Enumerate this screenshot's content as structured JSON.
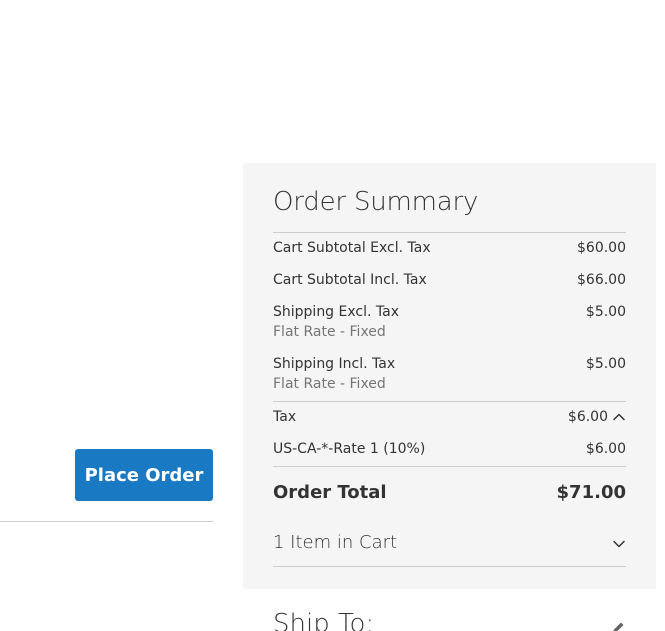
{
  "checkout": {
    "place_order_label": "Place Order"
  },
  "summary": {
    "title": "Order Summary",
    "cart_subtotal_excl_label": "Cart Subtotal Excl. Tax",
    "cart_subtotal_excl_value": "$60.00",
    "cart_subtotal_incl_label": "Cart Subtotal Incl. Tax",
    "cart_subtotal_incl_value": "$66.00",
    "shipping_excl_label": "Shipping Excl. Tax",
    "shipping_excl_method": "Flat Rate - Fixed",
    "shipping_excl_value": "$5.00",
    "shipping_incl_label": "Shipping Incl. Tax",
    "shipping_incl_method": "Flat Rate - Fixed",
    "shipping_incl_value": "$5.00",
    "tax_label": "Tax",
    "tax_value": "$6.00",
    "tax_expanded": true,
    "tax_rate_label": "US-CA-*-Rate 1 (10%)",
    "tax_rate_value": "$6.00",
    "order_total_label": "Order Total",
    "order_total_value": "$71.00",
    "items_in_cart_label": "1 Item in Cart"
  },
  "ship_to": {
    "title": "Ship To:"
  },
  "icons": {
    "tax_toggle": "chevron-up-icon",
    "items_toggle": "chevron-down-icon",
    "edit": "pencil-icon"
  },
  "colors": {
    "primary_button": "#1979c3",
    "summary_background": "#f5f5f5",
    "divider": "#cccccc",
    "text": "#333333",
    "muted_text": "#757575"
  }
}
